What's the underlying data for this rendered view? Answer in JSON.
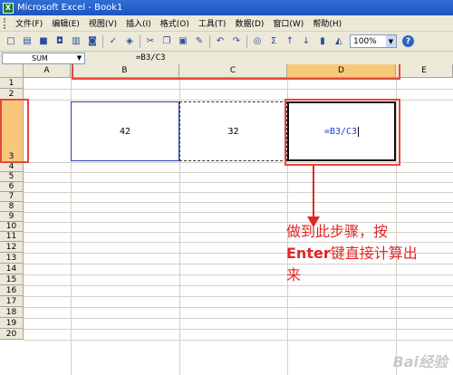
{
  "window": {
    "title": "Microsoft Excel - Book1",
    "app_icon": "X"
  },
  "menu": {
    "items": [
      "文件(F)",
      "编辑(E)",
      "视图(V)",
      "插入(I)",
      "格式(O)",
      "工具(T)",
      "数据(D)",
      "窗口(W)",
      "帮助(H)"
    ]
  },
  "toolbar": {
    "zoom": "100%",
    "help": "?"
  },
  "formula_bar": {
    "name_box": "SUM",
    "formula": "=B3/C3"
  },
  "grid": {
    "columns": [
      "A",
      "B",
      "C",
      "D",
      "E"
    ],
    "rows": [
      "1",
      "2",
      "3",
      "4",
      "5",
      "6",
      "7",
      "8",
      "9",
      "10",
      "11",
      "12",
      "13",
      "14",
      "15",
      "16",
      "17",
      "18",
      "19",
      "20"
    ],
    "active_column": "D",
    "active_row": "3"
  },
  "cells": {
    "B3": "42",
    "C3": "32",
    "D3": "=B3/C3"
  },
  "annotation": {
    "line1": "做到此步骤，按",
    "line2_key": "Enter",
    "line2_rest": "键直接计算出",
    "line3": "来"
  },
  "colors": {
    "highlight": "#f7c87a",
    "annotation_red": "#e32626",
    "formula_blue": "#1f3fcf"
  },
  "watermark": "Bai经验"
}
